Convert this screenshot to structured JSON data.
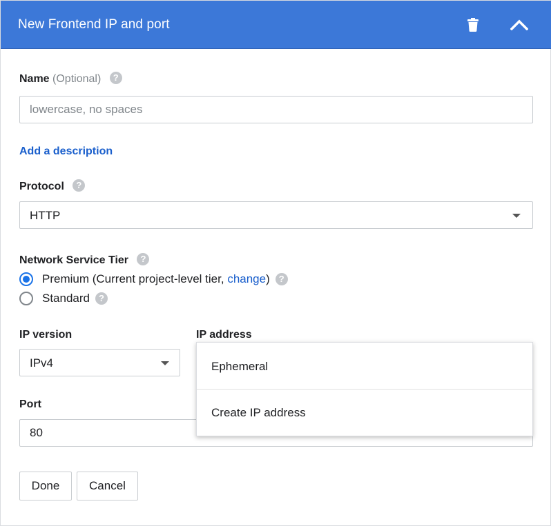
{
  "header": {
    "title": "New Frontend IP and port",
    "delete_icon": "trash-icon",
    "collapse_icon": "chevron-up-icon",
    "background": "#3c78d8"
  },
  "name": {
    "label": "Name",
    "optional": "(Optional)",
    "placeholder": "lowercase, no spaces",
    "value": ""
  },
  "description_link": "Add a description",
  "protocol": {
    "label": "Protocol",
    "selected": "HTTP"
  },
  "network_tier": {
    "label": "Network Service Tier",
    "options": [
      {
        "label_before": "Premium (Current project-level tier, ",
        "link": "change",
        "label_after": ")",
        "checked": true
      },
      {
        "label_before": "Standard",
        "checked": false
      }
    ]
  },
  "ip_version": {
    "label": "IP version",
    "selected": "IPv4"
  },
  "ip_address": {
    "label": "IP address",
    "options": [
      "Ephemeral",
      "Create IP address"
    ]
  },
  "port": {
    "label": "Port",
    "value": "80"
  },
  "actions": {
    "done": "Done",
    "cancel": "Cancel"
  },
  "colors": {
    "accent": "#1a73e8",
    "link": "#1a5fcc"
  }
}
